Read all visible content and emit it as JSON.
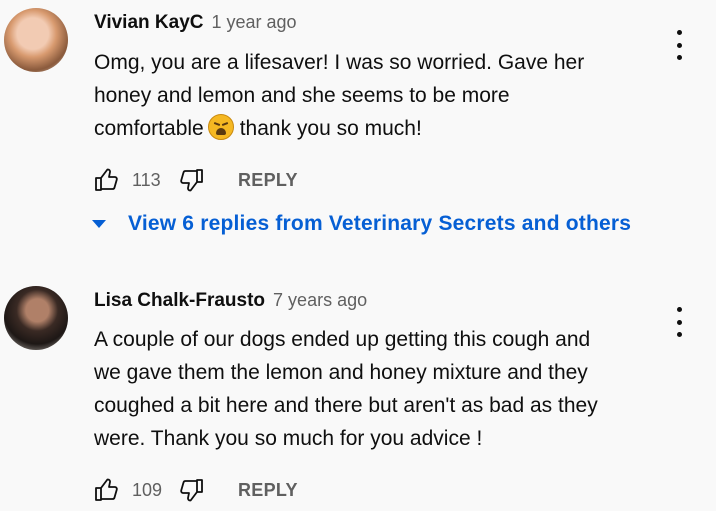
{
  "comments": [
    {
      "author": "Vivian KayC",
      "time": "1 year ago",
      "lines": [
        "Omg, you are a lifesaver! I was so worried. Gave her",
        "honey and lemon and she seems to be more",
        "comfortable",
        "thank you so much!"
      ],
      "likes": "113",
      "reply_label": "REPLY",
      "view_replies": "View 6 replies from Veterinary Secrets and others",
      "emoji": "weary-face-emoji"
    },
    {
      "author": "Lisa Chalk-Frausto",
      "time": "7 years ago",
      "lines": [
        "A couple of our dogs ended up getting this cough and",
        "we gave them the lemon and honey mixture and they",
        "coughed a bit here and there but aren't as bad as they",
        "were. Thank you so much for you advice !"
      ],
      "likes": "109",
      "reply_label": "REPLY"
    }
  ],
  "colors": {
    "link": "#065fd4",
    "muted": "#606060",
    "background": "#f9f9f9"
  }
}
